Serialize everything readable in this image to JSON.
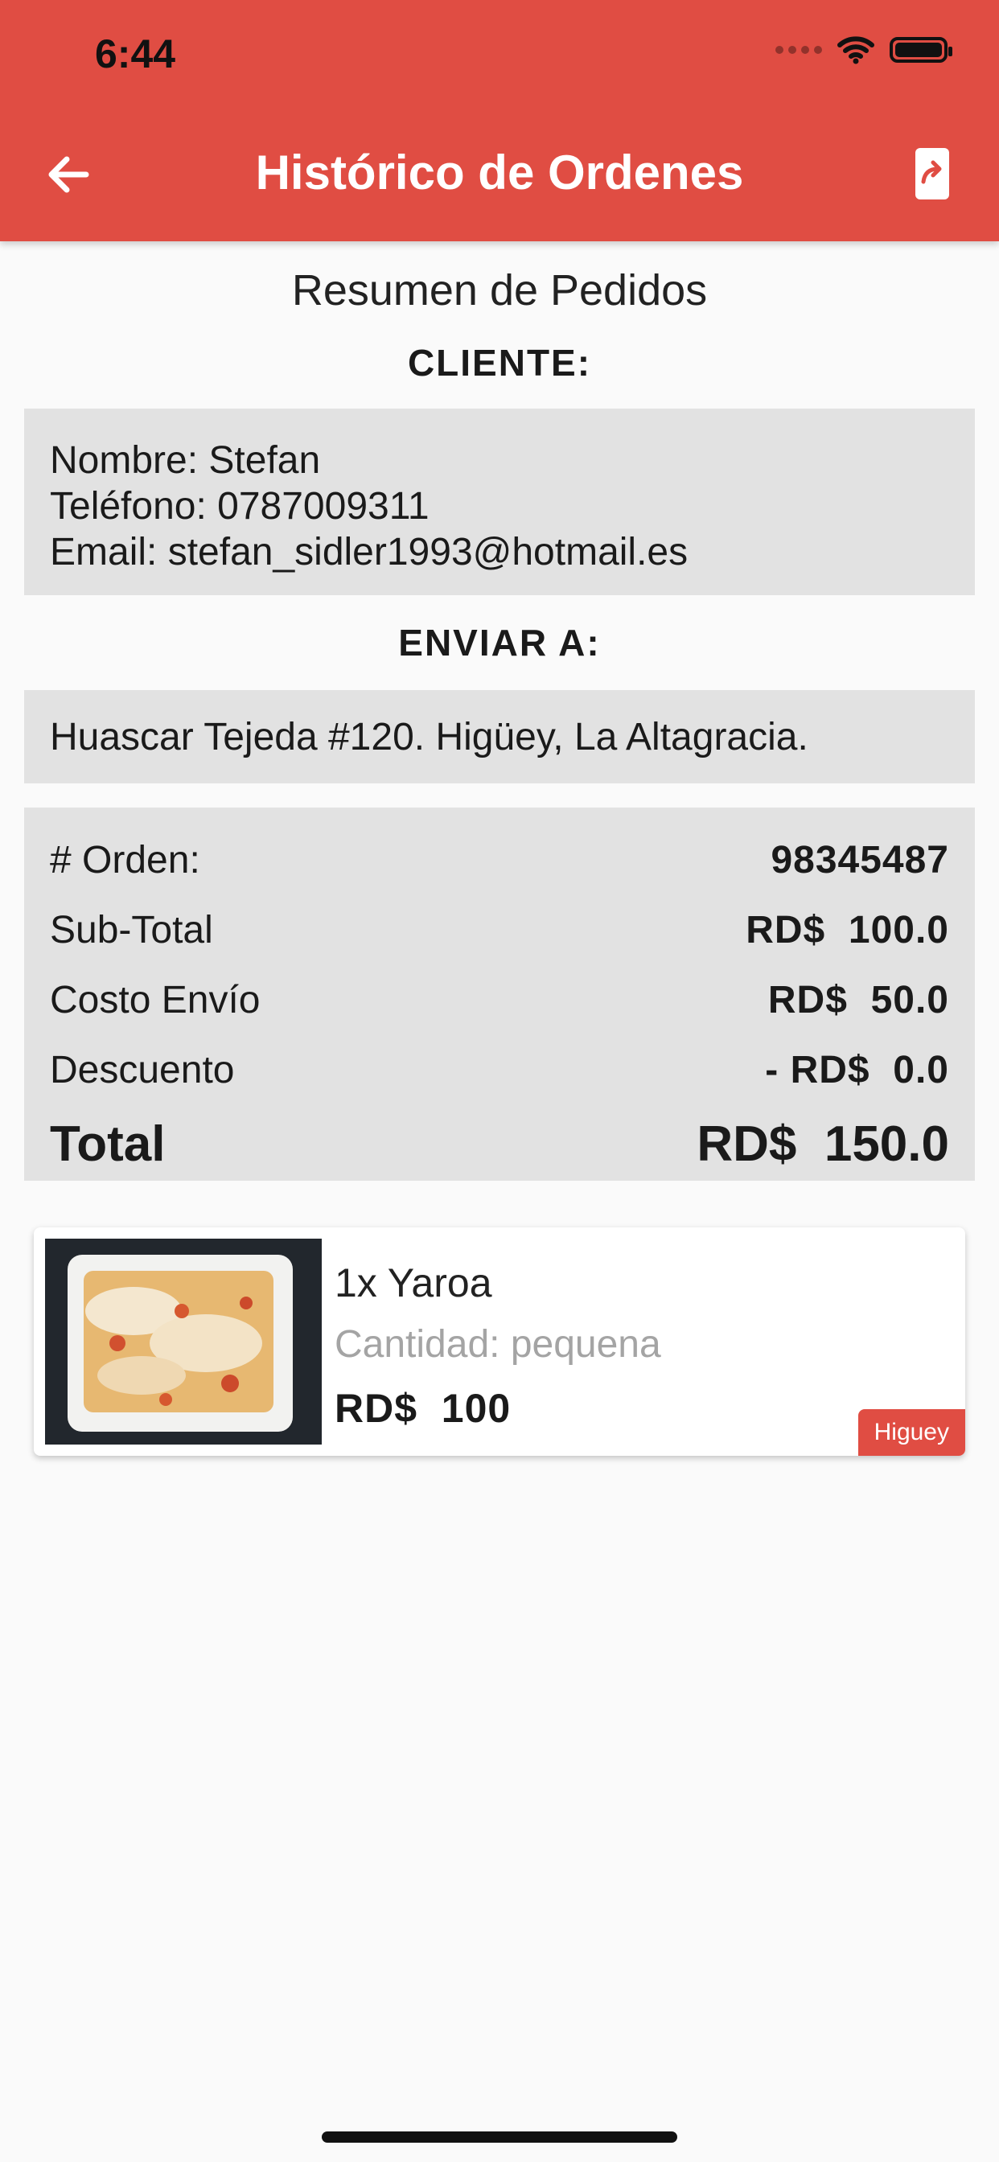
{
  "status_bar": {
    "time": "6:44"
  },
  "header": {
    "title": "Histórico de Ordenes",
    "back_icon": "arrow-left-icon",
    "share_icon": "share-phone-icon",
    "color": "#e04d43"
  },
  "summary": {
    "title": "Resumen de Pedidos",
    "client_heading": "CLIENTE:",
    "client": {
      "name": "Nombre: Stefan",
      "phone": "Teléfono: 0787009311",
      "email": "Email: stefan_sidler1993@hotmail.es"
    },
    "ship_heading": "ENVIAR A:",
    "address": "Huascar Tejeda #120. Higüey, La Altagracia."
  },
  "totals": {
    "order_label": "# Orden:",
    "order_value": "98345487",
    "subtotal_label": "Sub-Total",
    "subtotal_value": "RD$  100.0",
    "shipping_label": "Costo Envío",
    "shipping_value": "RD$  50.0",
    "discount_label": "Descuento",
    "discount_value": "- RD$  0.0",
    "total_label": "Total",
    "total_value": "RD$  150.0"
  },
  "items": [
    {
      "name": "1x Yaroa",
      "quantity": "Cantidad: pequena",
      "price": "RD$  100",
      "badge": "Higuey"
    }
  ]
}
